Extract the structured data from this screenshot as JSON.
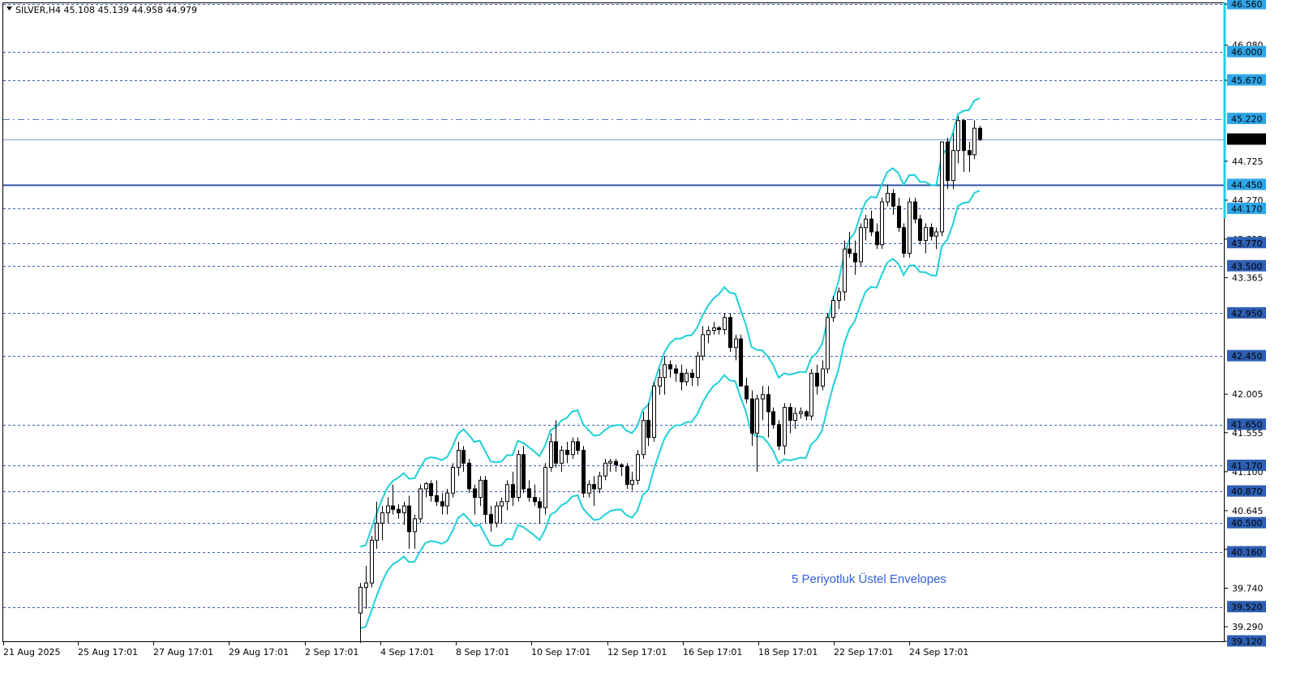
{
  "chart_data": {
    "type": "candlestick",
    "title": "SILVER,H4  45.108 45.139 44.958 44.979",
    "symbol": "SILVER,H4",
    "ohlc_readout": [
      "45.108",
      "45.139",
      "44.958",
      "44.979"
    ],
    "annotation": "5 Periyotluk Üstel Envelopes",
    "ylim": [
      39.12,
      46.56
    ],
    "current_price": "44.979",
    "price_axis_labels": [
      "46.560",
      "46.080",
      "45.670",
      "44.725",
      "44.270",
      "43.815",
      "43.365",
      "42.005",
      "41.555",
      "41.100",
      "40.645",
      "40.195",
      "39.740",
      "39.290",
      "39.120"
    ],
    "levels": [
      {
        "price": 46.56,
        "label": "46.560",
        "style": "dashed",
        "highlight": true
      },
      {
        "price": 46.0,
        "label": "46.000",
        "style": "dashed",
        "highlight": true
      },
      {
        "price": 45.67,
        "label": "45.670",
        "style": "dashed",
        "highlight": true
      },
      {
        "price": 45.22,
        "label": "45.220",
        "style": "dashdot",
        "highlight": true
      },
      {
        "price": 44.45,
        "label": "44.450",
        "style": "solid",
        "highlight": true
      },
      {
        "price": 44.17,
        "label": "44.170",
        "style": "dashed",
        "highlight": true
      },
      {
        "price": 43.77,
        "label": "43.770",
        "style": "dashed",
        "highlight": false
      },
      {
        "price": 43.5,
        "label": "43.500",
        "style": "dashed",
        "highlight": false
      },
      {
        "price": 42.95,
        "label": "42.950",
        "style": "dashed",
        "highlight": false
      },
      {
        "price": 42.45,
        "label": "42.450",
        "style": "dashed",
        "highlight": false
      },
      {
        "price": 41.65,
        "label": "41.650",
        "style": "dashed",
        "highlight": false
      },
      {
        "price": 41.17,
        "label": "41.170",
        "style": "dashed",
        "highlight": false
      },
      {
        "price": 40.87,
        "label": "40.870",
        "style": "dashed",
        "highlight": false
      },
      {
        "price": 40.5,
        "label": "40.500",
        "style": "dashed",
        "highlight": false
      },
      {
        "price": 40.16,
        "label": "40.160",
        "style": "dashed",
        "highlight": false
      },
      {
        "price": 39.52,
        "label": "39.520",
        "style": "dashed",
        "highlight": false
      },
      {
        "price": 39.12,
        "label": "39.120",
        "style": "dashed",
        "highlight": false
      }
    ],
    "x_labels": [
      "21 Aug 2025",
      "25 Aug 17:01",
      "27 Aug 17:01",
      "29 Aug 17:01",
      "2 Sep 17:01",
      "4 Sep 17:01",
      "8 Sep 17:01",
      "10 Sep 17:01",
      "12 Sep 17:01",
      "16 Sep 17:01",
      "18 Sep 17:01",
      "22 Sep 17:01",
      "24 Sep 17:01"
    ],
    "candles": [
      [
        39.45,
        39.8,
        39.1,
        39.75
      ],
      [
        39.75,
        40.0,
        39.5,
        39.8
      ],
      [
        39.8,
        40.35,
        39.75,
        40.3
      ],
      [
        40.3,
        40.75,
        40.2,
        40.5
      ],
      [
        40.5,
        40.7,
        40.3,
        40.62
      ],
      [
        40.62,
        40.8,
        40.5,
        40.7
      ],
      [
        40.7,
        40.95,
        40.6,
        40.66
      ],
      [
        40.66,
        40.72,
        40.55,
        40.62
      ],
      [
        40.62,
        40.75,
        40.48,
        40.7
      ],
      [
        40.7,
        40.82,
        40.2,
        40.4
      ],
      [
        40.4,
        40.6,
        40.2,
        40.55
      ],
      [
        40.55,
        40.95,
        40.5,
        40.9
      ],
      [
        40.9,
        40.98,
        40.8,
        40.96
      ],
      [
        40.96,
        41.0,
        40.75,
        40.82
      ],
      [
        40.82,
        41.0,
        40.7,
        40.75
      ],
      [
        40.75,
        40.85,
        40.6,
        40.7
      ],
      [
        40.7,
        40.9,
        40.6,
        40.85
      ],
      [
        40.85,
        41.2,
        40.8,
        41.15
      ],
      [
        41.15,
        41.45,
        41.05,
        41.35
      ],
      [
        41.35,
        41.4,
        41.1,
        41.2
      ],
      [
        41.2,
        41.25,
        40.85,
        40.9
      ],
      [
        40.9,
        40.95,
        40.6,
        40.8
      ],
      [
        40.8,
        41.05,
        40.7,
        41.0
      ],
      [
        41.0,
        41.05,
        40.5,
        40.6
      ],
      [
        40.6,
        40.7,
        40.4,
        40.5
      ],
      [
        40.5,
        40.75,
        40.45,
        40.7
      ],
      [
        40.7,
        40.8,
        40.5,
        40.75
      ],
      [
        40.75,
        41.0,
        40.65,
        40.95
      ],
      [
        40.95,
        41.1,
        40.7,
        40.8
      ],
      [
        40.8,
        41.35,
        40.75,
        41.3
      ],
      [
        41.3,
        41.4,
        40.85,
        40.9
      ],
      [
        40.9,
        41.0,
        40.75,
        40.8
      ],
      [
        40.8,
        40.95,
        40.7,
        40.75
      ],
      [
        40.75,
        40.8,
        40.5,
        40.68
      ],
      [
        40.68,
        41.2,
        40.6,
        41.15
      ],
      [
        41.15,
        41.55,
        41.1,
        41.45
      ],
      [
        41.45,
        41.7,
        41.15,
        41.2
      ],
      [
        41.2,
        41.4,
        41.1,
        41.35
      ],
      [
        41.35,
        41.45,
        41.2,
        41.3
      ],
      [
        41.3,
        41.5,
        41.25,
        41.45
      ],
      [
        41.45,
        41.5,
        41.3,
        41.35
      ],
      [
        41.35,
        41.4,
        40.8,
        40.85
      ],
      [
        40.85,
        41.0,
        40.8,
        40.95
      ],
      [
        40.95,
        41.05,
        40.7,
        40.9
      ],
      [
        40.9,
        41.1,
        40.85,
        41.05
      ],
      [
        41.05,
        41.25,
        41.0,
        41.2
      ],
      [
        41.2,
        41.25,
        41.1,
        41.22
      ],
      [
        41.22,
        41.25,
        41.1,
        41.18
      ],
      [
        41.18,
        41.2,
        41.05,
        41.16
      ],
      [
        41.16,
        41.2,
        40.9,
        40.95
      ],
      [
        40.95,
        41.1,
        40.88,
        41.0
      ],
      [
        41.0,
        41.35,
        40.95,
        41.3
      ],
      [
        41.3,
        41.8,
        41.25,
        41.7
      ],
      [
        41.7,
        41.9,
        41.4,
        41.5
      ],
      [
        41.5,
        42.15,
        41.45,
        42.1
      ],
      [
        42.1,
        42.3,
        42.0,
        42.2
      ],
      [
        42.2,
        42.45,
        42.0,
        42.35
      ],
      [
        42.35,
        42.4,
        42.2,
        42.3
      ],
      [
        42.3,
        42.35,
        42.15,
        42.25
      ],
      [
        42.25,
        42.35,
        42.05,
        42.15
      ],
      [
        42.15,
        42.3,
        42.1,
        42.25
      ],
      [
        42.25,
        42.3,
        42.1,
        42.2
      ],
      [
        42.2,
        42.5,
        42.1,
        42.45
      ],
      [
        42.45,
        42.8,
        42.4,
        42.7
      ],
      [
        42.7,
        42.8,
        42.6,
        42.75
      ],
      [
        42.75,
        42.85,
        42.7,
        42.78
      ],
      [
        42.78,
        42.8,
        42.7,
        42.76
      ],
      [
        42.76,
        42.95,
        42.7,
        42.9
      ],
      [
        42.9,
        42.95,
        42.5,
        42.55
      ],
      [
        42.55,
        42.7,
        42.4,
        42.65
      ],
      [
        42.65,
        42.7,
        42.2,
        42.1
      ],
      [
        42.1,
        42.2,
        41.9,
        41.95
      ],
      [
        41.95,
        42.05,
        41.4,
        41.55
      ],
      [
        41.55,
        42.0,
        41.1,
        41.95
      ],
      [
        41.95,
        42.1,
        41.7,
        42.0
      ],
      [
        42.0,
        42.1,
        41.5,
        41.8
      ],
      [
        41.8,
        41.85,
        41.6,
        41.65
      ],
      [
        41.65,
        41.7,
        41.35,
        41.4
      ],
      [
        41.4,
        41.9,
        41.3,
        41.85
      ],
      [
        41.85,
        41.9,
        41.55,
        41.7
      ],
      [
        41.7,
        41.85,
        41.6,
        41.78
      ],
      [
        41.78,
        41.85,
        41.72,
        41.8
      ],
      [
        41.8,
        41.82,
        41.7,
        41.75
      ],
      [
        41.75,
        42.3,
        41.7,
        42.25
      ],
      [
        42.25,
        42.35,
        42.0,
        42.1
      ],
      [
        42.1,
        42.4,
        42.05,
        42.3
      ],
      [
        42.3,
        42.95,
        42.25,
        42.9
      ],
      [
        42.9,
        43.15,
        42.85,
        43.1
      ],
      [
        43.1,
        43.25,
        43.0,
        43.2
      ],
      [
        43.2,
        43.8,
        43.1,
        43.7
      ],
      [
        43.7,
        43.9,
        43.6,
        43.65
      ],
      [
        43.65,
        43.8,
        43.4,
        43.55
      ],
      [
        43.55,
        44.0,
        43.5,
        43.95
      ],
      [
        43.95,
        44.1,
        43.8,
        44.05
      ],
      [
        44.05,
        44.15,
        43.85,
        43.9
      ],
      [
        43.9,
        44.0,
        43.7,
        43.75
      ],
      [
        43.75,
        44.3,
        43.7,
        44.25
      ],
      [
        44.25,
        44.45,
        44.2,
        44.35
      ],
      [
        44.35,
        44.4,
        44.1,
        44.2
      ],
      [
        44.2,
        44.3,
        43.9,
        43.95
      ],
      [
        43.95,
        44.0,
        43.6,
        43.65
      ],
      [
        43.65,
        44.3,
        43.6,
        44.25
      ],
      [
        44.25,
        44.3,
        44.0,
        44.05
      ],
      [
        44.05,
        44.1,
        43.75,
        43.8
      ],
      [
        43.8,
        44.0,
        43.65,
        43.95
      ],
      [
        43.95,
        44.0,
        43.8,
        43.85
      ],
      [
        43.85,
        43.95,
        43.7,
        43.9
      ],
      [
        43.9,
        44.6,
        43.85,
        44.95
      ],
      [
        44.95,
        45.0,
        44.4,
        44.5
      ],
      [
        44.5,
        45.05,
        44.4,
        44.85
      ],
      [
        44.85,
        45.25,
        44.7,
        45.2
      ],
      [
        45.2,
        45.22,
        44.6,
        44.85
      ],
      [
        44.85,
        44.95,
        44.6,
        44.8
      ],
      [
        44.8,
        45.2,
        44.75,
        45.11
      ],
      [
        45.11,
        45.14,
        44.96,
        44.98
      ]
    ]
  }
}
